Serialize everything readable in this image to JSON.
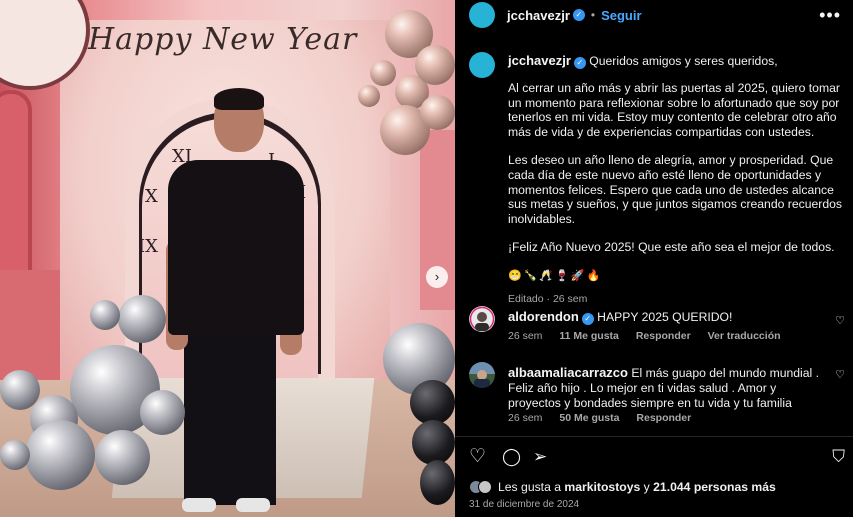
{
  "photo": {
    "headline": "Happy New Year",
    "next_icon": "chevron-right-icon",
    "next_glyph": "›"
  },
  "post": {
    "username": "jcchavezjr",
    "follow_label": "Seguir",
    "more_icon": "more-horizontal-icon",
    "more_glyph": "•••",
    "verified_glyph": "✓",
    "separator": "•"
  },
  "caption": {
    "username": "jcchavezjr",
    "greeting": "Queridos amigos y seres queridos,",
    "paragraph1": "Al cerrar un año más y abrir las puertas al 2025, quiero tomar un momento para reflexionar sobre lo afortunado que soy por tenerlos en mi vida. Estoy muy contento de celebrar otro año más de vida y de experiencias compartidas con ustedes.",
    "paragraph2": "Les deseo un año lleno de alegría, amor y prosperidad. Que cada día de este nuevo año esté lleno de oportunidades y momentos felices. Espero que cada uno de ustedes alcance sus metas y sueños, y que juntos sigamos creando recuerdos inolvidables.",
    "paragraph3": "¡Feliz Año Nuevo 2025! Que este año sea el mejor de todos.",
    "emojis": "😁🍾🥂🍷🚀🔥",
    "meta": "Editado · 26 sem"
  },
  "comments": [
    {
      "username": "aldorendon",
      "verified": true,
      "text": "HAPPY 2025 QUERIDO!",
      "time": "26 sem",
      "likes": "11 Me gusta",
      "reply": "Responder",
      "translate": "Ver traducción"
    },
    {
      "username": "albaamaliacarrazco",
      "verified": false,
      "text": "El más guapo del mundo mundial . Feliz año hijo . Lo mejor en ti vidas salud . Amor y proyectos y bondades siempre en tu vida y tu familia",
      "time": "26 sem",
      "likes": "50 Me gusta",
      "reply": "Responder"
    }
  ],
  "actions": {
    "like_icon": "heart-icon",
    "like_glyph": "♡",
    "comment_icon": "comment-icon",
    "comment_glyph": "◯",
    "share_icon": "send-icon",
    "share_glyph": "➢",
    "save_icon": "bookmark-icon",
    "save_glyph": "⛉",
    "comment_like_glyph": "♡"
  },
  "likes": {
    "prefix": "Les gusta a",
    "user": "markitostoys",
    "connector": "y",
    "others": "21.044 personas más"
  },
  "date": "31 de diciembre de 2024",
  "colors": {
    "accent": "#4aa8ff",
    "verified": "#3897f0",
    "avatar": "#26b3d6",
    "muted": "#a8a8a8"
  }
}
